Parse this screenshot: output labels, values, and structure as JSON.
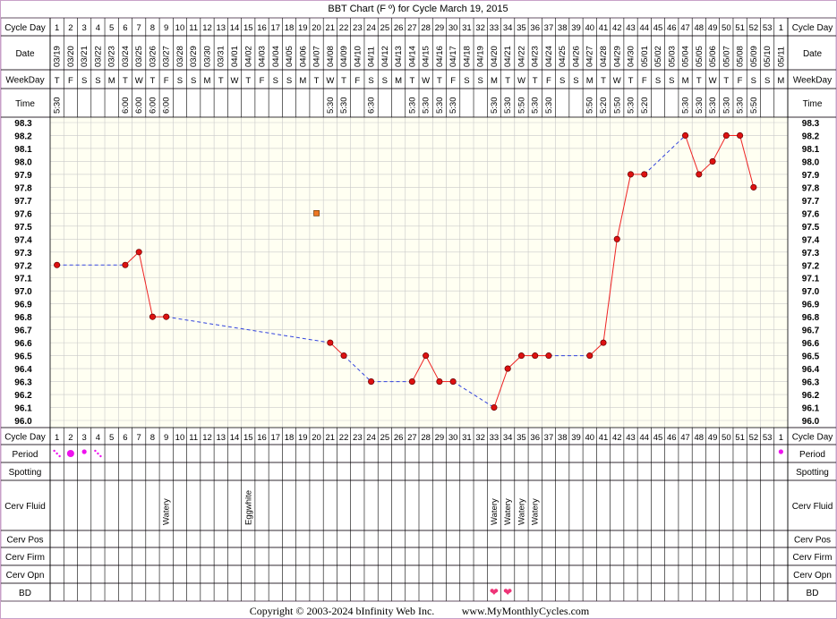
{
  "chart_data": {
    "type": "line",
    "title": "BBT Chart (F º) for Cycle March 19, 2015",
    "ylim": [
      96.0,
      98.3
    ],
    "y_ticks": [
      "98.3",
      "98.2",
      "98.1",
      "98.0",
      "97.9",
      "97.8",
      "97.7",
      "97.6",
      "97.5",
      "97.4",
      "97.3",
      "97.2",
      "97.1",
      "97.0",
      "96.9",
      "96.8",
      "96.7",
      "96.6",
      "96.5",
      "96.4",
      "96.3",
      "96.2",
      "96.1",
      "96.0"
    ],
    "cycle_days": [
      "1",
      "2",
      "3",
      "4",
      "5",
      "6",
      "7",
      "8",
      "9",
      "10",
      "11",
      "12",
      "13",
      "14",
      "15",
      "16",
      "17",
      "18",
      "19",
      "20",
      "21",
      "22",
      "23",
      "24",
      "25",
      "26",
      "27",
      "28",
      "29",
      "30",
      "31",
      "32",
      "33",
      "34",
      "35",
      "36",
      "37",
      "38",
      "39",
      "40",
      "41",
      "42",
      "43",
      "44",
      "45",
      "46",
      "47",
      "48",
      "49",
      "50",
      "51",
      "52",
      "53",
      "1"
    ],
    "dates": [
      "03/19",
      "03/20",
      "03/21",
      "03/22",
      "03/23",
      "03/24",
      "03/25",
      "03/26",
      "03/27",
      "03/28",
      "03/29",
      "03/30",
      "03/31",
      "04/01",
      "04/02",
      "04/03",
      "04/04",
      "04/05",
      "04/06",
      "04/07",
      "04/08",
      "04/09",
      "04/10",
      "04/11",
      "04/12",
      "04/13",
      "04/14",
      "04/15",
      "04/16",
      "04/17",
      "04/18",
      "04/19",
      "04/20",
      "04/21",
      "04/22",
      "04/23",
      "04/24",
      "04/25",
      "04/26",
      "04/27",
      "04/28",
      "04/29",
      "04/30",
      "05/01",
      "05/02",
      "05/03",
      "05/04",
      "05/05",
      "05/06",
      "05/07",
      "05/08",
      "05/09",
      "05/10",
      "05/11"
    ],
    "weekdays": [
      "T",
      "F",
      "S",
      "S",
      "M",
      "T",
      "W",
      "T",
      "F",
      "S",
      "S",
      "M",
      "T",
      "W",
      "T",
      "F",
      "S",
      "S",
      "M",
      "T",
      "W",
      "T",
      "F",
      "S",
      "S",
      "M",
      "T",
      "W",
      "T",
      "F",
      "S",
      "S",
      "M",
      "T",
      "W",
      "T",
      "F",
      "S",
      "S",
      "M",
      "T",
      "W",
      "T",
      "F",
      "S",
      "S",
      "M",
      "T",
      "W",
      "T",
      "F",
      "S",
      "S",
      "M"
    ],
    "times": [
      "5:30",
      "",
      "",
      "",
      "",
      "6:00",
      "6:00",
      "6:00",
      "6:00",
      "",
      "",
      "",
      "",
      "",
      "",
      "",
      "",
      "",
      "",
      "",
      "5:30",
      "5:30",
      "",
      "6:30",
      "",
      "",
      "5:30",
      "5:30",
      "5:30",
      "5:30",
      "",
      "",
      "5:30",
      "5:30",
      "5:50",
      "5:30",
      "5:30",
      "",
      "",
      "5:50",
      "5:20",
      "5:50",
      "5:30",
      "5:20",
      "",
      "",
      "5:30",
      "5:30",
      "5:30",
      "5:30",
      "5:30",
      "5:50",
      "",
      ""
    ],
    "temps": [
      97.2,
      null,
      null,
      null,
      null,
      97.2,
      97.3,
      96.8,
      96.8,
      null,
      null,
      null,
      null,
      null,
      null,
      null,
      null,
      null,
      null,
      null,
      96.6,
      96.5,
      null,
      96.3,
      null,
      null,
      96.3,
      96.5,
      96.3,
      96.3,
      null,
      null,
      96.1,
      96.4,
      96.5,
      96.5,
      96.5,
      null,
      null,
      96.5,
      96.6,
      97.4,
      97.9,
      97.9,
      null,
      null,
      98.2,
      97.9,
      98.0,
      98.2,
      98.2,
      97.8,
      null,
      null
    ],
    "excluded_points": [
      {
        "day_index": 19,
        "value": 97.6
      }
    ],
    "row_labels": {
      "cycle_day": "Cycle Day",
      "date": "Date",
      "weekday": "WeekDay",
      "time": "Time",
      "period": "Period",
      "spotting": "Spotting",
      "cerv_fluid": "Cerv Fluid",
      "cerv_pos": "Cerv Pos",
      "cerv_firm": "Cerv Firm",
      "cerv_opn": "Cerv Opn",
      "bd": "BD"
    },
    "period": [
      {
        "day_index": 0,
        "level": "spotting"
      },
      {
        "day_index": 1,
        "level": "heavy"
      },
      {
        "day_index": 2,
        "level": "medium"
      },
      {
        "day_index": 3,
        "level": "spotting"
      },
      {
        "day_index": 53,
        "level": "medium"
      }
    ],
    "cerv_fluid": [
      {
        "day_index": 8,
        "value": "Watery"
      },
      {
        "day_index": 14,
        "value": "Eggwhite"
      },
      {
        "day_index": 32,
        "value": "Watery"
      },
      {
        "day_index": 33,
        "value": "Watery"
      },
      {
        "day_index": 34,
        "value": "Watery"
      },
      {
        "day_index": 35,
        "value": "Watery"
      }
    ],
    "bd": [
      32,
      33
    ],
    "colors": {
      "line": "#ee2222",
      "dashed": "#3344dd",
      "point": "#dd1111",
      "excluded": "#ee7722",
      "plot_bg": "#fffff2",
      "grid": "#c9c9c9",
      "border": "#c8a0c8",
      "period": "#ee11ee",
      "heart": "#ee3377"
    }
  },
  "footer": {
    "copyright": "Copyright © 2003-2024 bInfinity Web Inc.",
    "website": "www.MyMonthlyCycles.com"
  }
}
